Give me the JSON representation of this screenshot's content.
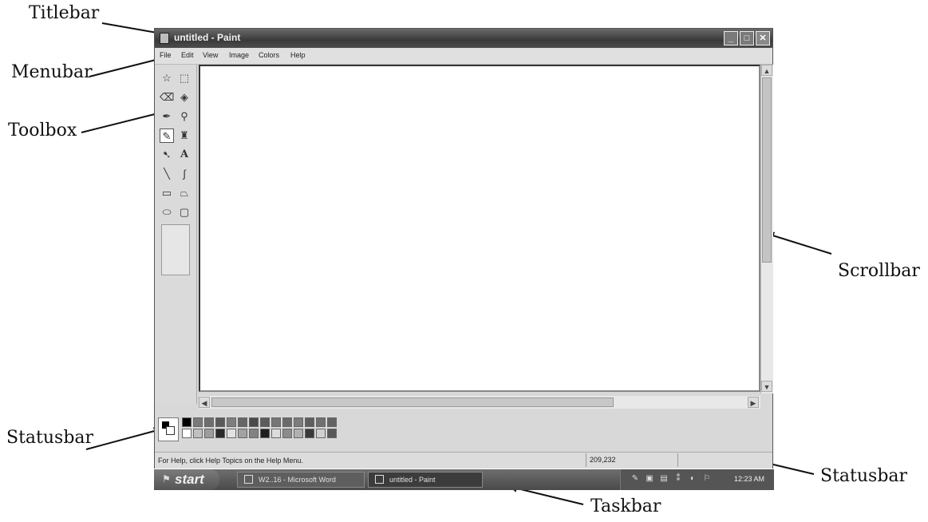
{
  "annotations": {
    "titlebar": "Titlebar",
    "menubar": "Menubar",
    "toolbox": "Toolbox",
    "scrollbar": "Scrollbar",
    "statusbar_left": "Statusbar",
    "statusbar_right": "Statusbar",
    "taskbar": "Taskbar"
  },
  "window": {
    "title": "untitled - Paint",
    "minimize_glyph": "_",
    "maximize_glyph": "□",
    "close_glyph": "✕"
  },
  "menubar": {
    "items": [
      "File",
      "Edit",
      "View",
      "Image",
      "Colors",
      "Help"
    ]
  },
  "toolbox": {
    "tools": [
      {
        "name": "free-form-select",
        "glyph": "☆"
      },
      {
        "name": "rectangle-select",
        "glyph": "⬚"
      },
      {
        "name": "eraser",
        "glyph": "⌫"
      },
      {
        "name": "fill-with-color",
        "glyph": "◈"
      },
      {
        "name": "pick-color",
        "glyph": "✒"
      },
      {
        "name": "magnifier",
        "glyph": "⚲"
      },
      {
        "name": "pencil",
        "glyph": "✎"
      },
      {
        "name": "brush",
        "glyph": "♜"
      },
      {
        "name": "airbrush",
        "glyph": "➷"
      },
      {
        "name": "text",
        "glyph": "A"
      },
      {
        "name": "line",
        "glyph": "╲"
      },
      {
        "name": "curve",
        "glyph": "∫"
      },
      {
        "name": "rectangle",
        "glyph": "▭"
      },
      {
        "name": "polygon",
        "glyph": "⏢"
      },
      {
        "name": "ellipse",
        "glyph": "⬭"
      },
      {
        "name": "rounded-rectangle",
        "glyph": "▢"
      }
    ],
    "selected_tool": "pencil"
  },
  "palette": {
    "foreground": "#000000",
    "background": "#ffffff",
    "top_row": [
      "#000000",
      "#7a7a7a",
      "#6e6e6e",
      "#5a5a5a",
      "#7e7e7e",
      "#666666",
      "#4a4a4a",
      "#5c5c5c",
      "#767676",
      "#6a6a6a",
      "#7c7c7c",
      "#5e5e5e",
      "#707070",
      "#646464"
    ],
    "bottom_row": [
      "#ffffff",
      "#c0c0c0",
      "#9c9c9c",
      "#2a2a2a",
      "#e2e2e2",
      "#a2a2a2",
      "#828282",
      "#1e1e1e",
      "#dcdcdc",
      "#8c8c8c",
      "#b0b0b0",
      "#3a3a3a",
      "#d0d0d0",
      "#585858"
    ]
  },
  "statusbar": {
    "help_text": "For Help, click Help Topics on the Help Menu.",
    "coordinates": "209,232"
  },
  "taskbar": {
    "start_label": "start",
    "buttons": [
      {
        "label": "W2..16 - Microsoft Word",
        "active": false
      },
      {
        "label": "untitled - Paint",
        "active": true
      }
    ],
    "tray_icons": [
      "pen-icon",
      "network-icon",
      "monitor-icon",
      "signal-icon",
      "speaker-icon",
      "flag-icon"
    ],
    "clock": "12:23 AM"
  }
}
